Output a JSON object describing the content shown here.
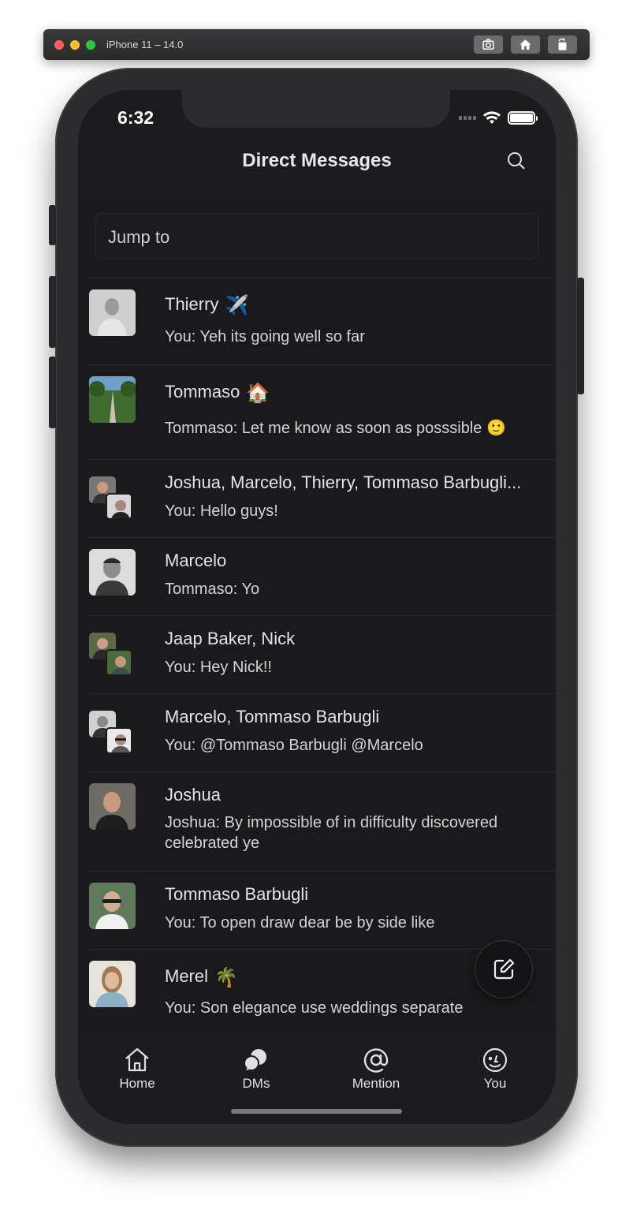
{
  "simulator": {
    "title": "iPhone 11 – 14.0"
  },
  "status_bar": {
    "time": "6:32"
  },
  "header": {
    "title": "Direct Messages"
  },
  "jump_to": {
    "label": "Jump to"
  },
  "conversations": [
    {
      "name": "Thierry",
      "status_emoji": "✈️",
      "message": "You:  Yeh its going well so far"
    },
    {
      "name": "Tommaso",
      "status_emoji": "🏠",
      "message": "Tommaso: Let me know as soon as posssible 🙂"
    },
    {
      "name": "Joshua, Marcelo, Thierry, Tommaso Barbugli...",
      "message": "You:  Hello guys!"
    },
    {
      "name": "Marcelo",
      "message": "Tommaso: Yo"
    },
    {
      "name": "Jaap Baker, Nick",
      "message": "You:  Hey Nick!!"
    },
    {
      "name": "Marcelo, Tommaso Barbugli",
      "message": "You:  @Tommaso Barbugli @Marcelo"
    },
    {
      "name": "Joshua",
      "message": "Joshua: By impossible of in difficulty discovered celebrated ye"
    },
    {
      "name": "Tommaso Barbugli",
      "message": "You:  To open draw dear be by side like"
    },
    {
      "name": "Merel",
      "status_emoji": "🌴",
      "message": "You:  Son elegance use weddings separate"
    }
  ],
  "tabs": [
    {
      "label": "Home",
      "icon": "home-icon"
    },
    {
      "label": "DMs",
      "icon": "chat-bubbles-icon"
    },
    {
      "label": "Mention",
      "icon": "at-sign-icon"
    },
    {
      "label": "You",
      "icon": "smiley-icon"
    }
  ],
  "fab": {
    "icon": "compose-icon"
  }
}
